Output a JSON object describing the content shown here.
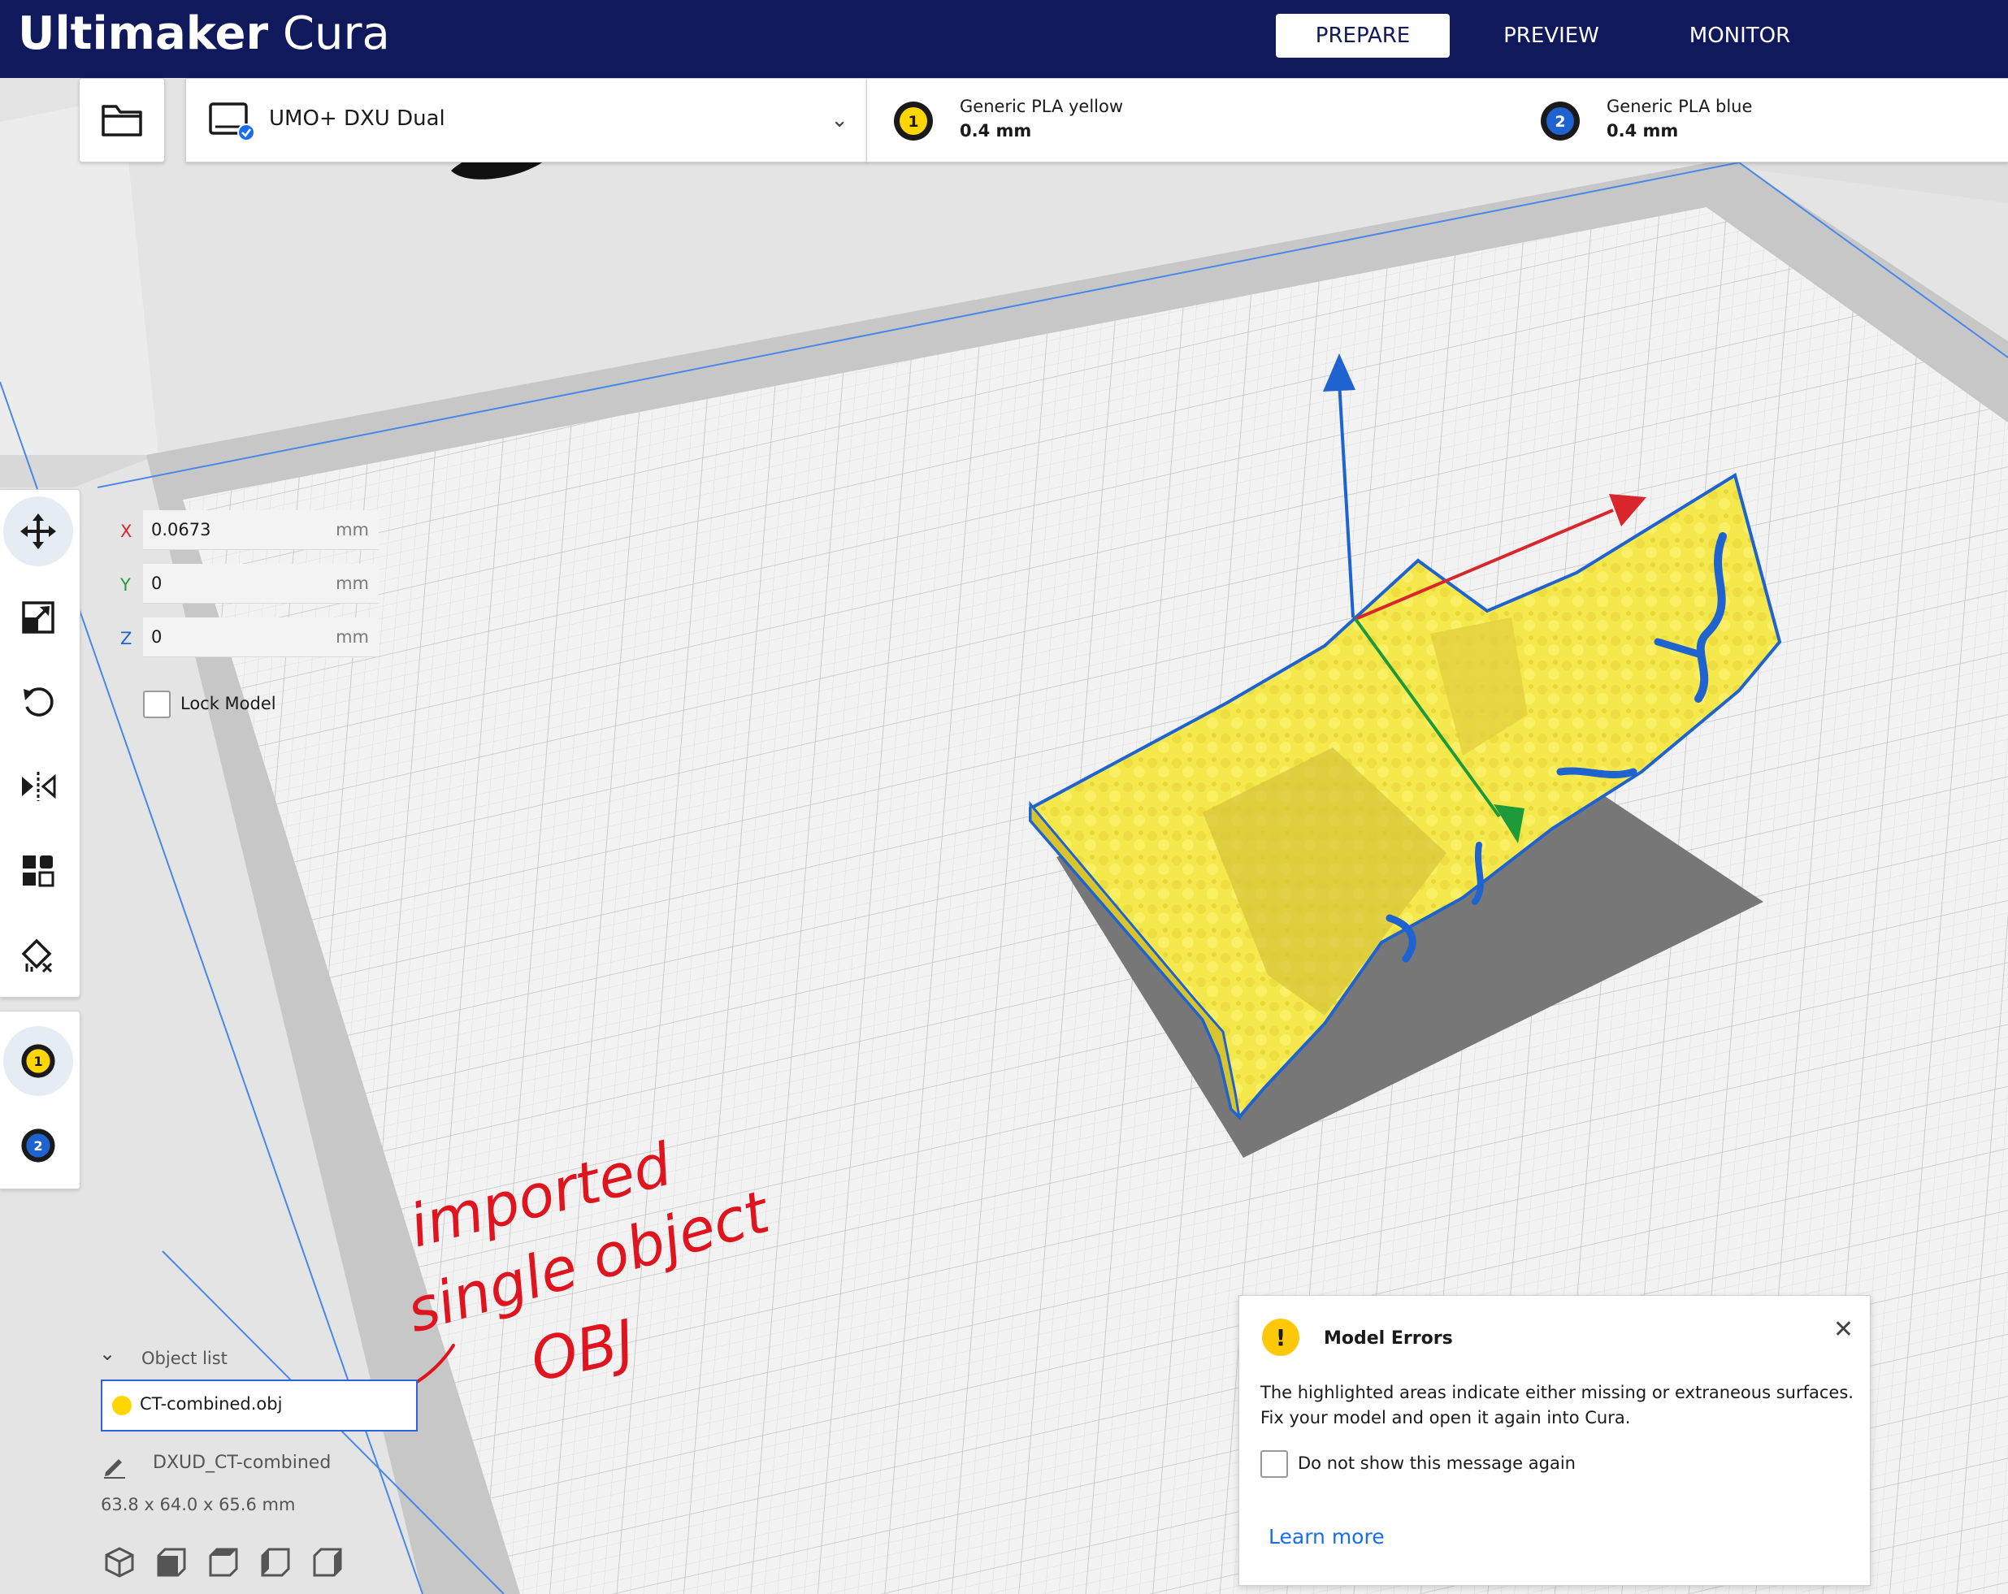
{
  "app": {
    "brand_bold": "Ultimaker",
    "brand_light": "Cura"
  },
  "stages": [
    {
      "label": "PREPARE",
      "active": true
    },
    {
      "label": "PREVIEW",
      "active": false
    },
    {
      "label": "MONITOR",
      "active": false
    }
  ],
  "printer": {
    "name": "UMO+ DXU Dual"
  },
  "materials": [
    {
      "index": "1",
      "name": "Generic PLA yellow",
      "nozzle": "0.4 mm",
      "color": "#ffd600"
    },
    {
      "index": "2",
      "name": "Generic PLA blue",
      "nozzle": "0.4 mm",
      "color": "#1e63d0"
    }
  ],
  "move_panel": {
    "x_label": "X",
    "x_value": "0.0673",
    "x_unit": "mm",
    "y_label": "Y",
    "y_value": "0",
    "y_unit": "mm",
    "z_label": "Z",
    "z_value": "0",
    "z_unit": "mm",
    "lock_label": "Lock Model"
  },
  "tools": [
    "move-icon",
    "scale-icon",
    "rotate-icon",
    "mirror-icon",
    "per-model-settings-icon",
    "support-blocker-icon"
  ],
  "extruder_buttons": [
    "1",
    "2"
  ],
  "object_list": {
    "header": "Object list",
    "items": [
      {
        "name": "CT-combined.obj"
      }
    ],
    "job_name": "DXUD_CT-combined",
    "dimensions": "63.8 x 64.0 x 65.6 mm"
  },
  "view_buttons": [
    "3d-view-icon",
    "front-view-icon",
    "top-view-icon",
    "left-view-icon",
    "right-view-icon"
  ],
  "message": {
    "title": "Model Errors",
    "body": "The highlighted areas indicate either missing or extraneous surfaces. Fix your model and open it again into Cura.",
    "checkbox_label": "Do not show this message again",
    "link": "Learn more"
  },
  "annotation": {
    "line1": "imported",
    "line2": "single object",
    "line3": "OBJ",
    "color": "#e0141e"
  },
  "colors": {
    "titlebar": "#10195c",
    "model": "#f5e84c",
    "model_outline": "#1e63d0",
    "axis_x": "#d9262c",
    "axis_y": "#1f9a3a",
    "axis_z": "#1e63d0",
    "build_plate": "#f3f3f3",
    "grid": "#d6d6d6"
  }
}
